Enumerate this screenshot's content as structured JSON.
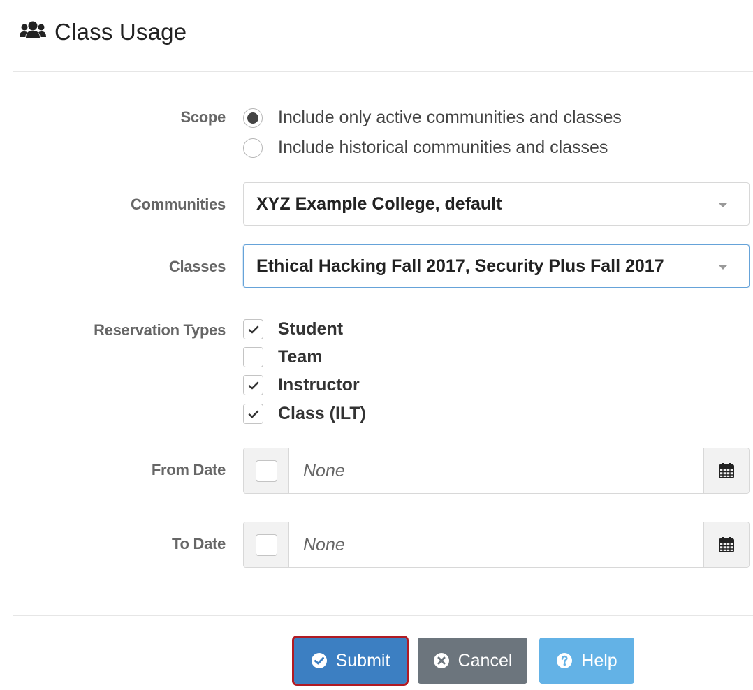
{
  "header": {
    "title": "Class Usage",
    "icon": "users-icon"
  },
  "scope": {
    "label": "Scope",
    "options": [
      {
        "text": "Include only active communities and classes",
        "selected": true
      },
      {
        "text": "Include historical communities and classes",
        "selected": false
      }
    ]
  },
  "communities": {
    "label": "Communities",
    "value": "XYZ Example College, default"
  },
  "classes": {
    "label": "Classes",
    "value": "Ethical Hacking Fall 2017, Security Plus Fall 2017"
  },
  "reservation_types": {
    "label": "Reservation Types",
    "items": [
      {
        "text": "Student",
        "checked": true
      },
      {
        "text": "Team",
        "checked": false
      },
      {
        "text": "Instructor",
        "checked": true
      },
      {
        "text": "Class (ILT)",
        "checked": true
      }
    ]
  },
  "from_date": {
    "label": "From Date",
    "placeholder": "None",
    "enabled": false
  },
  "to_date": {
    "label": "To Date",
    "placeholder": "None",
    "enabled": false
  },
  "buttons": {
    "submit": "Submit",
    "cancel": "Cancel",
    "help": "Help"
  },
  "colors": {
    "submit_bg": "#3c7fc2",
    "submit_highlight": "#b01b24",
    "cancel_bg": "#6c757d",
    "help_bg": "#63b2e6",
    "focus_border": "#66a3d9"
  }
}
